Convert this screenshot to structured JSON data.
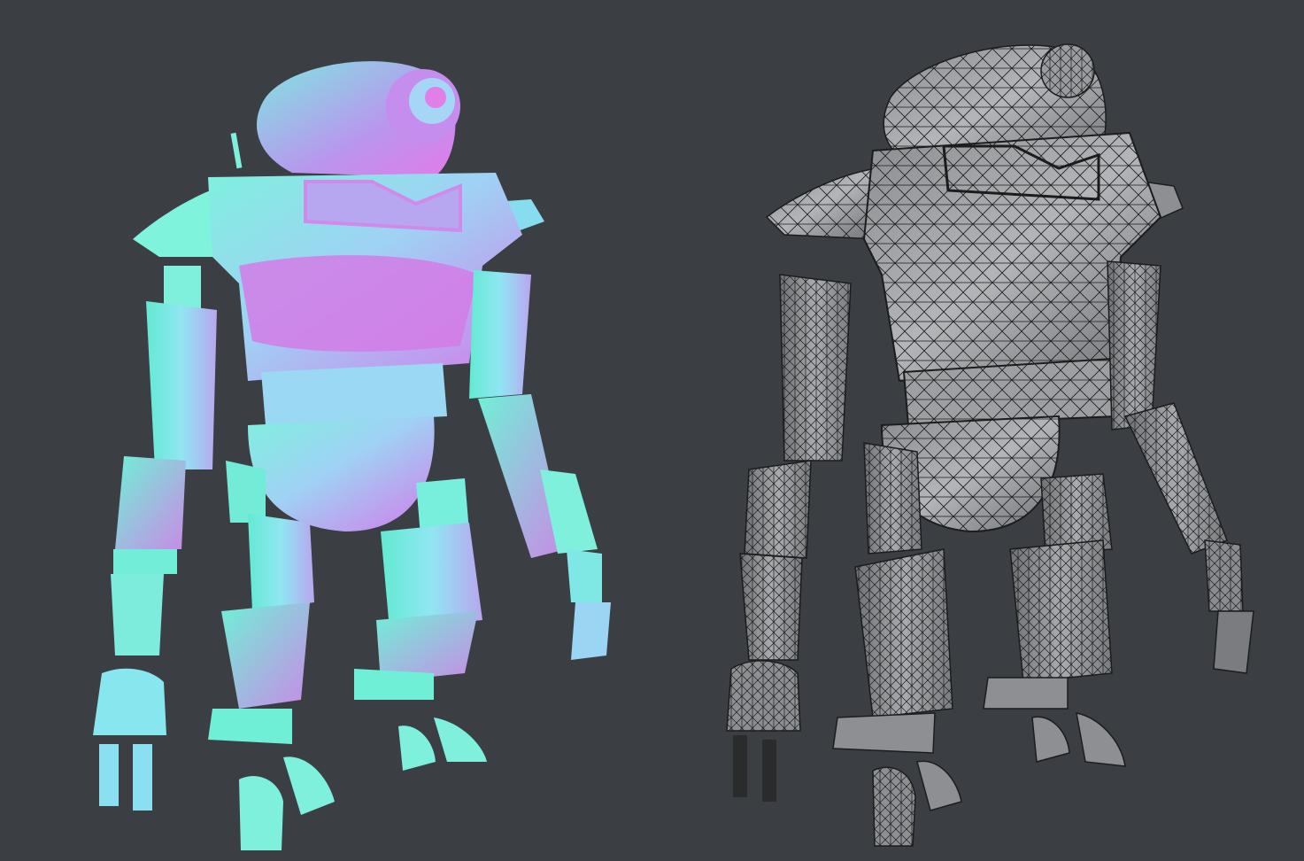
{
  "scene": {
    "background": "#3b3f44",
    "left_view": {
      "subject": "robot-normal-map-render",
      "colors": {
        "base": "#66e8d6",
        "highlight": "#c47be8",
        "shade": "#4fd0f0",
        "light": "#a6f2ea"
      }
    },
    "right_view": {
      "subject": "robot-wireframe-render",
      "colors": {
        "surface": "#7d7f82",
        "surface_light": "#b9bbbe",
        "wire": "#1b1c1e"
      }
    }
  }
}
